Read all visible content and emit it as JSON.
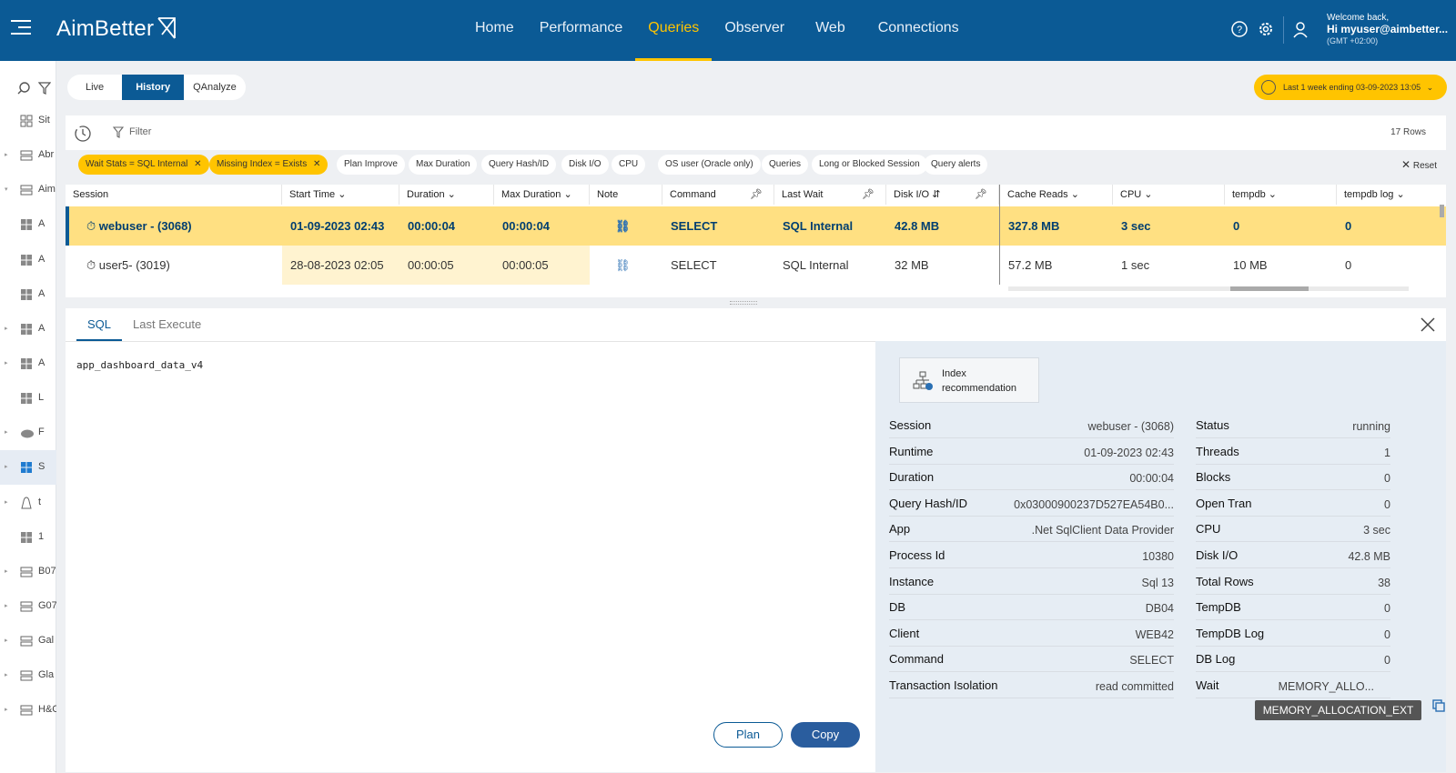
{
  "app": {
    "brand": "AimBetter",
    "nav": [
      "Home",
      "Performance",
      "Queries",
      "Observer",
      "Web",
      "Connections"
    ],
    "active_nav": "Queries",
    "user": {
      "welcome": "Welcome back,",
      "name": "Hi myuser@aimbetter...",
      "tz": "(GMT +02:00)"
    }
  },
  "sidebar": {
    "items": [
      {
        "label": "Sit",
        "icon": "grid-icon",
        "arrow": ""
      },
      {
        "label": "Abr",
        "icon": "server-icon",
        "arrow": "▸"
      },
      {
        "label": "Aim",
        "icon": "server-icon",
        "arrow": "▾"
      },
      {
        "label": "A",
        "icon": "windows-icon",
        "arrow": ""
      },
      {
        "label": "A",
        "icon": "windows-icon",
        "arrow": ""
      },
      {
        "label": "A",
        "icon": "windows-icon",
        "arrow": ""
      },
      {
        "label": "A",
        "icon": "windows-icon",
        "arrow": "▸"
      },
      {
        "label": "A",
        "icon": "windows-icon",
        "arrow": "▸"
      },
      {
        "label": "L",
        "icon": "windows-icon",
        "arrow": ""
      },
      {
        "label": "F",
        "icon": "aws-icon",
        "arrow": "▸"
      },
      {
        "label": "S",
        "icon": "windows-icon",
        "arrow": "▸"
      },
      {
        "label": "t",
        "icon": "linux-icon",
        "arrow": "▸"
      },
      {
        "label": "1",
        "icon": "windows-icon",
        "arrow": ""
      },
      {
        "label": "B07",
        "icon": "server-icon",
        "arrow": "▸"
      },
      {
        "label": "G07",
        "icon": "server-icon",
        "arrow": "▸"
      },
      {
        "label": "Gal",
        "icon": "server-icon",
        "arrow": "▸"
      },
      {
        "label": "Gla",
        "icon": "server-icon",
        "arrow": "▸"
      },
      {
        "label": "H&C",
        "icon": "server-icon",
        "arrow": "▸"
      }
    ]
  },
  "modes": {
    "live": "Live",
    "history": "History",
    "qanalyze": "QAnalyze"
  },
  "time_range": "Last 1 week ending  03-09-2023 13:05",
  "toolbar": {
    "filter": "Filter",
    "rows": "17 Rows"
  },
  "chips": [
    {
      "label": "Wait Stats = SQL Internal",
      "active": true
    },
    {
      "label": "Missing Index = Exists",
      "active": true
    },
    {
      "label": "Plan Improve",
      "active": false
    },
    {
      "label": "Max Duration",
      "active": false
    },
    {
      "label": "Query Hash/ID",
      "active": false
    },
    {
      "label": "Disk I/O",
      "active": false
    },
    {
      "label": "CPU",
      "active": false
    },
    {
      "label": "OS user (Oracle only)",
      "active": false
    },
    {
      "label": "Queries",
      "active": false
    },
    {
      "label": "Long or Blocked Session",
      "active": false
    },
    {
      "label": "Query alerts",
      "active": false
    }
  ],
  "reset": "Reset",
  "table": {
    "headers": [
      "Session",
      "Start Time",
      "Duration",
      "Max Duration",
      "Note",
      "Command",
      "Last Wait",
      "Disk I/O",
      "Cache Reads",
      "CPU",
      "tempdb",
      "tempdb log"
    ],
    "rows": [
      {
        "session": "webuser - (3068)",
        "start": "01-09-2023 02:43",
        "duration": "00:00:04",
        "max": "00:00:04",
        "command": "SELECT",
        "wait": "SQL Internal",
        "disk": "42.8 MB",
        "cache": "327.8 MB",
        "cpu": "3 sec",
        "tempdb": "0",
        "tlog": "0"
      },
      {
        "session": "user5- (3019)",
        "start": "28-08-2023 02:05",
        "duration": "00:00:05",
        "max": "00:00:05",
        "command": "SELECT",
        "wait": "SQL Internal",
        "disk": "32 MB",
        "cache": "57.2 MB",
        "cpu": "1 sec",
        "tempdb": "10 MB",
        "tlog": "0"
      }
    ]
  },
  "detail": {
    "tabs": [
      "SQL",
      "Last Execute"
    ],
    "sql": "app_dashboard_data_v4",
    "plan": "Plan",
    "copy": "Copy",
    "index_btn": [
      "Index",
      "recommendation"
    ],
    "left": [
      [
        "Session",
        "webuser - (3068)"
      ],
      [
        "Runtime",
        "01-09-2023 02:43"
      ],
      [
        "Duration",
        "00:00:04"
      ],
      [
        "Query Hash/ID",
        "0x03000900237D527EA54B0..."
      ],
      [
        "App",
        ".Net SqlClient Data Provider"
      ],
      [
        "Process Id",
        "10380"
      ],
      [
        "Instance",
        "Sql 13"
      ],
      [
        "DB",
        "DB04"
      ],
      [
        "Client",
        "WEB42"
      ],
      [
        "Command",
        "SELECT"
      ],
      [
        "Transaction Isolation",
        "read committed"
      ]
    ],
    "right": [
      [
        "Status",
        "running"
      ],
      [
        "Threads",
        "1"
      ],
      [
        "Blocks",
        "0"
      ],
      [
        "Open Tran",
        "0"
      ],
      [
        "CPU",
        "3 sec"
      ],
      [
        "Disk I/O",
        "42.8 MB"
      ],
      [
        "Total Rows",
        "38"
      ],
      [
        "TempDB",
        "0"
      ],
      [
        "TempDB Log",
        "0"
      ],
      [
        "DB Log",
        "0"
      ],
      [
        "Wait",
        "MEMORY_ALLO..."
      ]
    ],
    "tooltip": "MEMORY_ALLOCATION_EXT"
  }
}
